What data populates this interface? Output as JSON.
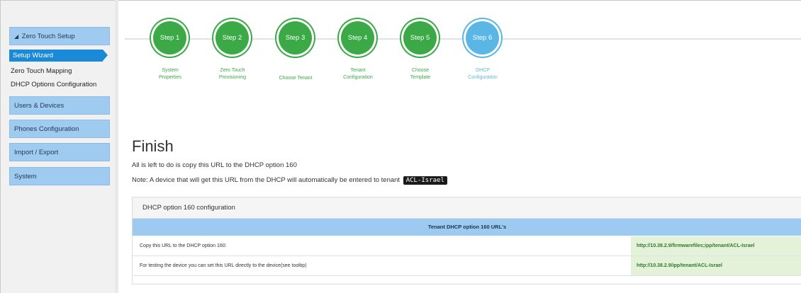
{
  "sidebar": {
    "zero_touch": {
      "arrow": "◢",
      "label": "Zero Touch Setup"
    },
    "sub_items": [
      {
        "label": "Setup Wizard",
        "active": true
      },
      {
        "label": "Zero Touch Mapping"
      },
      {
        "label": "DHCP Options Configuration"
      }
    ],
    "groups": [
      {
        "label": "Users & Devices"
      },
      {
        "label": "Phones Configuration"
      },
      {
        "label": "Import / Export"
      },
      {
        "label": "System"
      }
    ]
  },
  "wizard": {
    "steps": [
      {
        "label": "Step 1",
        "caption_line1": "System",
        "caption_line2": "Properties"
      },
      {
        "label": "Step 2",
        "caption_line1": "Zero Touch",
        "caption_line2": "Provisioning"
      },
      {
        "label": "Step 3",
        "caption_line1": "Choose Tenant",
        "caption_line2": ""
      },
      {
        "label": "Step 4",
        "caption_line1": "Tenant",
        "caption_line2": "Configuration"
      },
      {
        "label": "Step 5",
        "caption_line1": "Choose",
        "caption_line2": "Template"
      },
      {
        "label": "Step 6",
        "caption_line1": "DHCP",
        "caption_line2": "Configuration",
        "current": true
      }
    ]
  },
  "main": {
    "title": "Finish",
    "line1": "All is left to do is copy this URL to the DHCP option 160",
    "line2_prefix": "Note: A device that will get this URL from the DHCP will automatically be entered to tenant",
    "tenant": "ACL-Israel"
  },
  "panel": {
    "title": "DHCP option 160 configuration",
    "table_header": "Tenant DHCP option 160 URL's",
    "rows": [
      {
        "label": "Copy this URL to the DHCP option 160:",
        "url": "http://10.38.2.9/firmwarefiles;ipp/tenant/ACL-Israel"
      },
      {
        "label": "For testing the device you can set this URL directly to the device(see tooltip)",
        "url": "http://10.38.2.9/ipp/tenant/ACL-Israel"
      }
    ]
  },
  "colors": {
    "step_done": "#3aa946",
    "step_current": "#5ab6e4",
    "sidebar_header": "#9fcbf0",
    "active_item": "#1a8ad8",
    "url_cell_bg": "#e4f2da"
  }
}
